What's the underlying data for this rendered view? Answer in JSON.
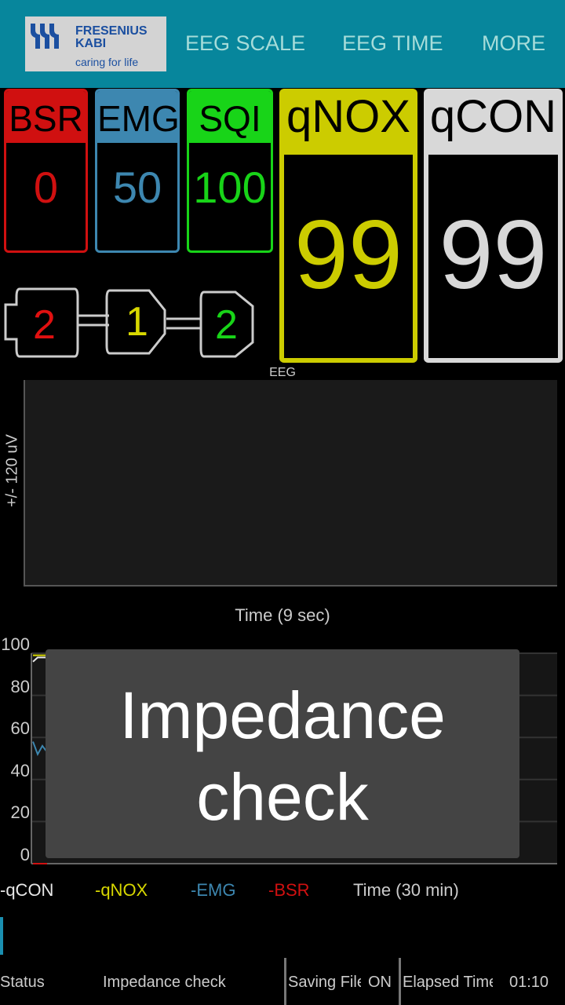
{
  "header": {
    "logo": {
      "brand_line1": "FRESENIUS",
      "brand_line2": "KABI",
      "tagline": "caring for life"
    },
    "menu": [
      "EEG SCALE",
      "EEG TIME",
      "MORE"
    ]
  },
  "tiles": [
    {
      "label": "BSR",
      "value": "0",
      "color": "#d01010"
    },
    {
      "label": "EMG",
      "value": "50",
      "color": "#3d87b0"
    },
    {
      "label": "SQI",
      "value": "100",
      "color": "#18d418"
    },
    {
      "label": "qNOX",
      "value": "99",
      "color": "#cccc00"
    },
    {
      "label": "qCON",
      "value": "99",
      "color": "#d8d8d8"
    }
  ],
  "electrodes": [
    {
      "value": "2",
      "color": "#e01010"
    },
    {
      "value": "1",
      "color": "#d8d800"
    },
    {
      "value": "2",
      "color": "#18d418"
    }
  ],
  "eeg": {
    "title": "EEG",
    "ylabel": "+/- 120 uV",
    "xlabel": "Time (9 sec)"
  },
  "chart_data": {
    "type": "line",
    "yticks": [
      "100",
      "80",
      "60",
      "40",
      "20",
      "0"
    ],
    "ylim": [
      0,
      100
    ],
    "xlabel": "Time (30 min)",
    "series": [
      {
        "name": "-qCON",
        "color": "#e8e8e8",
        "values": [
          96,
          98,
          98,
          98
        ]
      },
      {
        "name": "-qNOX",
        "color": "#d8d800",
        "values": [
          99,
          99,
          99,
          99
        ]
      },
      {
        "name": "-EMG",
        "color": "#3d87b0",
        "values": [
          58,
          52,
          56,
          53
        ]
      },
      {
        "name": "-BSR",
        "color": "#d01010",
        "values": [
          0,
          0,
          0,
          0
        ]
      }
    ]
  },
  "overlay": {
    "line1": "Impedance",
    "line2": "check"
  },
  "status": {
    "status_label": "Status",
    "status_value": "Impedance check",
    "saving_label": "Saving File",
    "saving_value": "ON",
    "elapsed_label": "Elapsed Time",
    "elapsed_value": "01:10"
  }
}
